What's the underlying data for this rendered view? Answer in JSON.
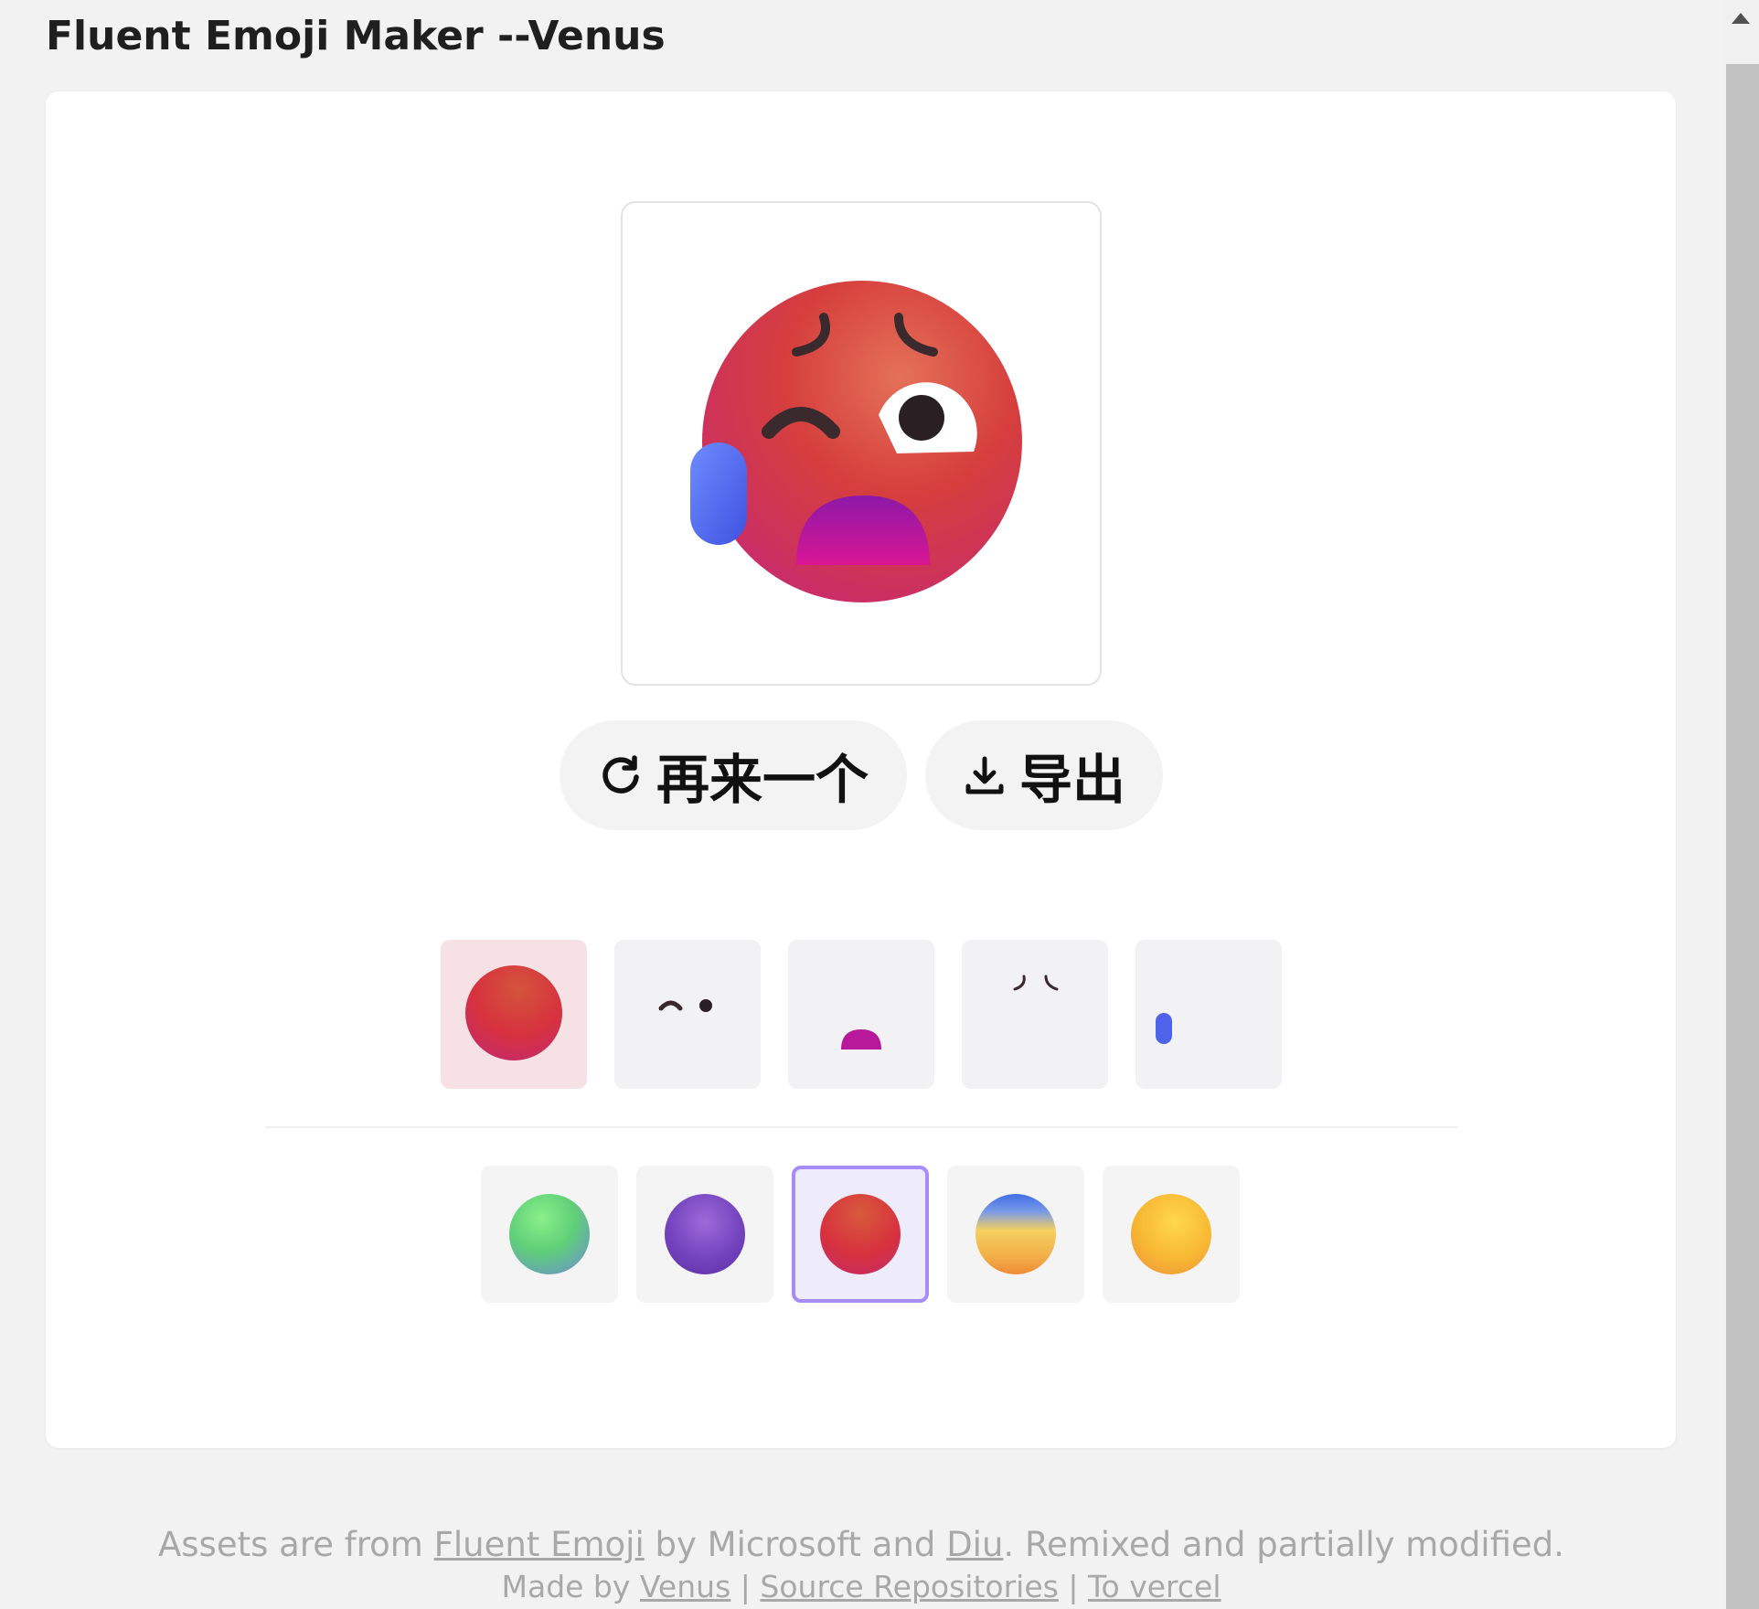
{
  "header": {
    "title": "Fluent Emoji Maker --Venus"
  },
  "actions": {
    "again_label": "再来一个",
    "export_label": "导出"
  },
  "parts": [
    {
      "name": "face-part",
      "selected": true
    },
    {
      "name": "eyes-part",
      "selected": false
    },
    {
      "name": "mouth-part",
      "selected": false
    },
    {
      "name": "eyebrows-part",
      "selected": false
    },
    {
      "name": "detail-part",
      "selected": false
    }
  ],
  "colors": [
    {
      "name": "green",
      "selected": false,
      "colors": [
        "#7be07c",
        "#4fb37f",
        "#7b8fe0"
      ]
    },
    {
      "name": "purple",
      "selected": false,
      "colors": [
        "#9b6ad6",
        "#6a3cb5",
        "#5a2aa0"
      ]
    },
    {
      "name": "red",
      "selected": true,
      "colors": [
        "#e06a4a",
        "#d2343c",
        "#c0206a"
      ]
    },
    {
      "name": "blue-yellow",
      "selected": false,
      "colors": [
        "#3b6fe0",
        "#f2c04a",
        "#f59a2a"
      ]
    },
    {
      "name": "yellow",
      "selected": false,
      "colors": [
        "#ffd43b",
        "#f7b733",
        "#f0952a"
      ]
    }
  ],
  "footer": {
    "line1_prefix": "Assets are from",
    "fluent_link": "Fluent Emoji",
    "line1_mid": "by Microsoft and",
    "diu_link": "Diu",
    "line1_suffix": ". Remixed and partially modified.",
    "made_by": "Made by",
    "venus_link": "Venus",
    "sep": "|",
    "source_link": "Source Repositories",
    "vercel_link": "To vercel"
  }
}
